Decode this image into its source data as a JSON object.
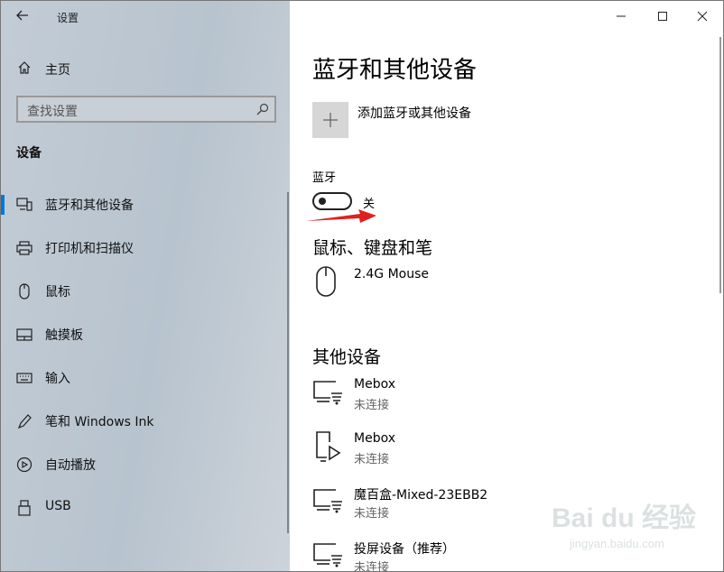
{
  "window": {
    "title": "设置"
  },
  "sidebar": {
    "home": "主页",
    "search_placeholder": "查找设置",
    "section": "设备",
    "items": [
      {
        "label": "蓝牙和其他设备",
        "icon": "bluetooth-devices-icon",
        "active": true
      },
      {
        "label": "打印机和扫描仪",
        "icon": "printer-icon"
      },
      {
        "label": "鼠标",
        "icon": "mouse-icon"
      },
      {
        "label": "触摸板",
        "icon": "touchpad-icon"
      },
      {
        "label": "输入",
        "icon": "keyboard-icon"
      },
      {
        "label": "笔和 Windows Ink",
        "icon": "pen-icon"
      },
      {
        "label": "自动播放",
        "icon": "autoplay-icon"
      },
      {
        "label": "USB",
        "icon": "usb-icon"
      }
    ]
  },
  "main": {
    "title": "蓝牙和其他设备",
    "add_device": "添加蓝牙或其他设备",
    "bluetooth": {
      "label": "蓝牙",
      "state": "关",
      "on": false
    },
    "mouse_section": {
      "title": "鼠标、键盘和笔",
      "devices": [
        {
          "name": "2.4G Mouse",
          "icon": "mouse-device-icon"
        }
      ]
    },
    "other_section": {
      "title": "其他设备",
      "devices": [
        {
          "name": "Mebox",
          "status": "未连接",
          "icon": "wireless-display-icon"
        },
        {
          "name": "Mebox",
          "status": "未连接",
          "icon": "media-device-icon"
        },
        {
          "name": "魔百盒-Mixed-23EBB2",
          "status": "未连接",
          "icon": "wireless-display-icon"
        },
        {
          "name": "投屏设备（推荐）",
          "status": "未连接",
          "icon": "wireless-display-icon"
        }
      ]
    }
  },
  "watermark": {
    "text": "Bai du 经验",
    "url": "jingyan.baidu.com"
  },
  "colors": {
    "accent": "#0078d7",
    "arrow": "#e02020"
  }
}
